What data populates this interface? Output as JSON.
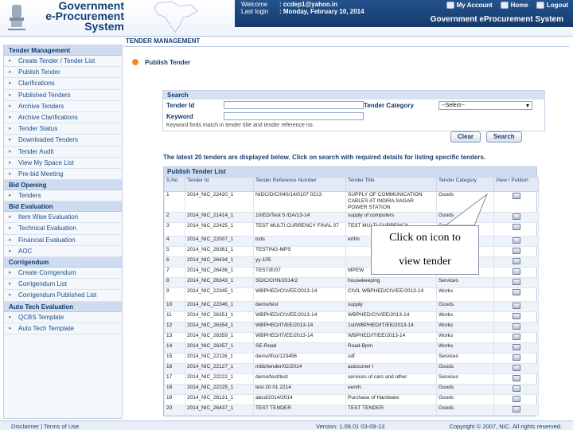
{
  "header": {
    "logo_line1": "Government",
    "logo_line2": "e-Procurement",
    "logo_line3": "System",
    "welcome_label": "Welcome",
    "welcome_value": ": ccdep1@yahoo.in",
    "last_login_label": "Last login",
    "last_login_value": ": Monday, February 10, 2014",
    "my_account": "My Account",
    "home": "Home",
    "logout": "Logout",
    "system_title": "Government eProcurement System"
  },
  "page_title": "TENDER MANAGEMENT",
  "sidebar": {
    "sections": [
      {
        "title": "Tender Management",
        "items": [
          "Create Tender / Tender List",
          "Publish Tender",
          "Clarifications",
          "Published Tenders",
          "Archive Tenders",
          "Archive Clarifications",
          "Tender Status",
          "Downloaded Tenders",
          "Tender Audit",
          "View My Space List",
          "Pre-bid Meeting"
        ]
      },
      {
        "title": "Bid Opening",
        "items": [
          "Tenders"
        ]
      },
      {
        "title": "Bid Evaluation",
        "items": [
          "Item Wise Evaluation",
          "Technical Evaluation",
          "Financial Evaluation",
          "AOC"
        ]
      },
      {
        "title": "Corrigendum",
        "items": [
          "Create Corrigendum",
          "Corrigendum List",
          "Corrigendum Published List"
        ]
      },
      {
        "title": "Auto Tech Evaluation",
        "items": [
          "QCBS Template",
          "Auto Tech Template"
        ]
      }
    ]
  },
  "publish": {
    "title": "Publish Tender",
    "search_title": "Search",
    "tender_id_label": "Tender Id",
    "tender_id_value": "",
    "keyword_label": "Keyword",
    "keyword_value": "",
    "hint": "Keyword finds match in tender title and tender reference no.",
    "category_label": "Tender Category",
    "category_value": "--Select--",
    "clear_label": "Clear",
    "search_label": "Search",
    "notice": "The latest 20 tenders are displayed below. Click on search with required details for listing specific tenders.",
    "list_title": "Publish Tender List",
    "columns": [
      "S.No",
      "Tender Id",
      "Tender Reference Number",
      "Tender Title",
      "Tender Category",
      "View / Publish"
    ],
    "rows": [
      {
        "sno": "1",
        "id": "2014_NIC_22420_1",
        "ref": "NIDC/D/C/040/14/0107 0213",
        "title": "SUPPLY OF COMMUNICATION CABLES AT INDIRA SAGAR POWER STATION",
        "cat": "Goods"
      },
      {
        "sno": "2",
        "id": "2014_NIC_21414_1",
        "ref": "10/ED/Test 5 /DA/13-14",
        "title": "supply of computers",
        "cat": "Goods"
      },
      {
        "sno": "3",
        "id": "2014_NIC_22425_1",
        "ref": "TEST MULTI CURRENCY FINAL 07",
        "title": "TEST MULTI CURRENCY",
        "cat": "Goods"
      },
      {
        "sno": "4",
        "id": "2014_NIC_22007_1",
        "ref": "tcds",
        "title": "erthh",
        "cat": ""
      },
      {
        "sno": "5",
        "id": "2014_NIC_26361_1",
        "ref": "TESTING-MPS",
        "title": "",
        "cat": ""
      },
      {
        "sno": "6",
        "id": "2014_NIC_26434_1",
        "ref": "yy-105",
        "title": "",
        "cat": ""
      },
      {
        "sno": "7",
        "id": "2014_NIC_26436_1",
        "ref": "TEST/E/07",
        "title": "MPEW",
        "cat": ""
      },
      {
        "sno": "8",
        "id": "2014_NIC_26343_1",
        "ref": "SD/C/CHN/2014/2",
        "title": "housekeeping",
        "cat": "Services"
      },
      {
        "sno": "9",
        "id": "2014_NIC_22345_1",
        "ref": "WBPHED/CIV/EE/2013-14",
        "title": "CIVIL WBPHED/CIV/EE/2013-14",
        "cat": "Works"
      },
      {
        "sno": "10",
        "id": "2014_NIC_22346_1",
        "ref": "demo/test",
        "title": "supply",
        "cat": "Goods"
      },
      {
        "sno": "11",
        "id": "2014_NIC_26351_1",
        "ref": "WBPHED/CIV/EE/2013-14",
        "title": "WBPHED/CIV/EE/2013-14",
        "cat": "Works"
      },
      {
        "sno": "12",
        "id": "2014_NIC_26354_1",
        "ref": "WBPHED/IT/EE/2013-14",
        "title": "1st/WBPHED/IT/EE/2013-14",
        "cat": "Works"
      },
      {
        "sno": "13",
        "id": "2014_NIC_26359_1",
        "ref": "WBPHED/IT/EE/2013-14",
        "title": "WBPHED/IT/EE/2013-14",
        "cat": "Works"
      },
      {
        "sno": "14",
        "id": "2014_NIC_26357_1",
        "ref": "SE-Road",
        "title": "Road-Bpm",
        "cat": "Works"
      },
      {
        "sno": "15",
        "id": "2014_NIC_22116_1",
        "ref": "demo/tfco/123456",
        "title": "sdf",
        "cat": "Services"
      },
      {
        "sno": "16",
        "id": "2014_NIC_22127_1",
        "ref": "mbb/tender/02/2014",
        "title": "autoconer I",
        "cat": "Goods"
      },
      {
        "sno": "17",
        "id": "2014_NIC_22222_1",
        "ref": "demo/test/test",
        "title": "services of cars and other",
        "cat": "Services"
      },
      {
        "sno": "18",
        "id": "2014_NIC_22225_1",
        "ref": "test 20 01 2214",
        "title": "eenrh",
        "cat": "Goods"
      },
      {
        "sno": "19",
        "id": "2014_NIC_26131_1",
        "ref": "abcd/2014/2014",
        "title": "Purchase of Hardware",
        "cat": "Goods"
      },
      {
        "sno": "20",
        "id": "2014_NIC_26437_1",
        "ref": "TEST TENDER",
        "title": "TEST TENDER",
        "cat": "Goods"
      }
    ]
  },
  "callout": {
    "line1": "Click on icon to",
    "line2": "view tender"
  },
  "footer": {
    "disclaimer": "Disclaimer",
    "separator": "|",
    "terms": "Terms of Use",
    "version": "Version: 1.09.01 03-09-13",
    "copyright": "Copyright © 2007, NIC. All rights reserved."
  },
  "colors": {
    "header_bar": "#1b4579",
    "sidebar_head": "#cfdcef",
    "accent_orange": "#f08c1d"
  }
}
